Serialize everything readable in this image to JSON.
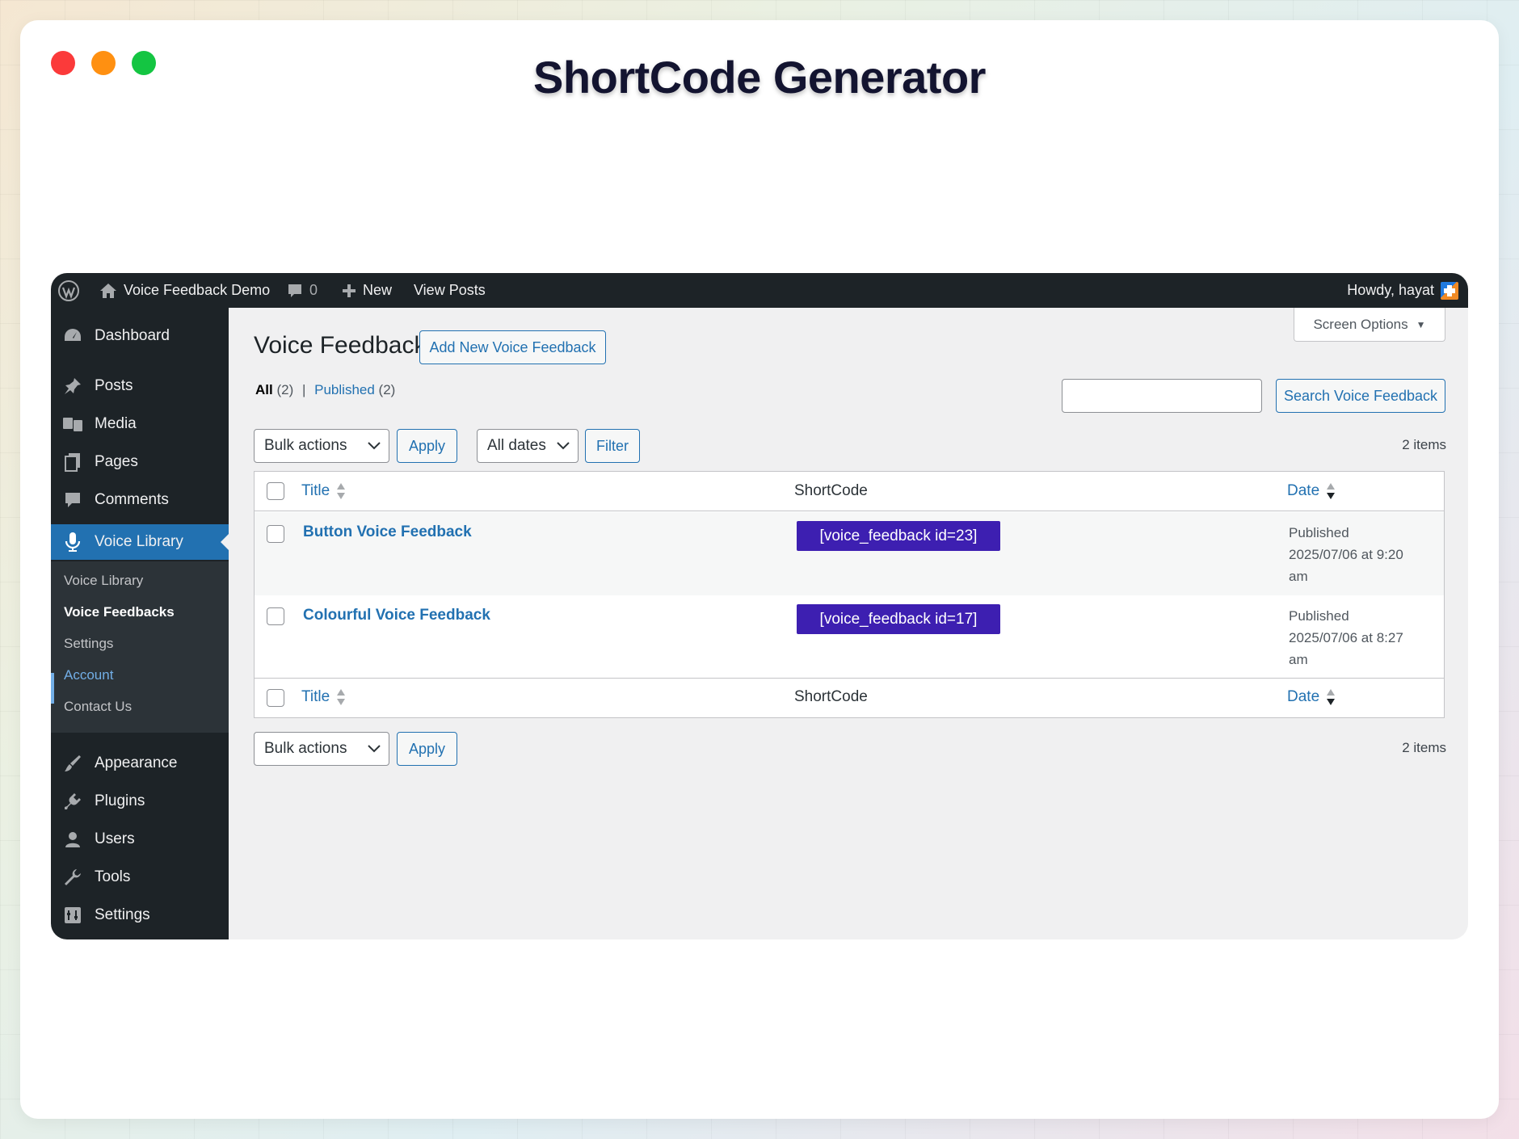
{
  "headline": "ShortCode Generator",
  "admin_bar": {
    "site_name": "Voice Feedback Demo",
    "comments_count": "0",
    "new_label": "New",
    "view_posts": "View Posts",
    "howdy": "Howdy, hayat"
  },
  "sidebar": {
    "items": [
      {
        "label": "Dashboard",
        "icon": "dashboard-icon"
      },
      {
        "label": "Posts",
        "icon": "pin-icon"
      },
      {
        "label": "Media",
        "icon": "media-icon"
      },
      {
        "label": "Pages",
        "icon": "pages-icon"
      },
      {
        "label": "Comments",
        "icon": "comment-icon"
      },
      {
        "label": "Voice Library",
        "icon": "microphone-icon"
      },
      {
        "label": "Appearance",
        "icon": "brush-icon"
      },
      {
        "label": "Plugins",
        "icon": "plugin-icon"
      },
      {
        "label": "Users",
        "icon": "user-icon"
      },
      {
        "label": "Tools",
        "icon": "wrench-icon"
      },
      {
        "label": "Settings",
        "icon": "settings-icon"
      }
    ],
    "submenu": [
      "Voice Library",
      "Voice Feedbacks",
      "Settings",
      "Account",
      "Contact Us"
    ]
  },
  "page": {
    "title": "Voice Feedbacks",
    "add_new": "Add New Voice Feedback",
    "screen_options": "Screen Options",
    "filter_all": "All",
    "filter_all_count": "(2)",
    "separator": "|",
    "filter_published": "Published",
    "filter_published_count": "(2)",
    "search_placeholder": "",
    "search_button": "Search Voice Feedback",
    "bulk_actions": "Bulk actions",
    "apply": "Apply",
    "all_dates": "All dates",
    "filter_button": "Filter",
    "items_count": "2 items"
  },
  "table": {
    "columns": {
      "title": "Title",
      "shortcode": "ShortCode",
      "date": "Date"
    },
    "rows": [
      {
        "title": "Button Voice Feedback",
        "shortcode": "[voice_feedback id=23]",
        "status": "Published",
        "date": "2025/07/06 at 9:20",
        "ampm": "am"
      },
      {
        "title": "Colourful Voice Feedback",
        "shortcode": "[voice_feedback id=17]",
        "status": "Published",
        "date": "2025/07/06 at 8:27",
        "ampm": "am"
      }
    ]
  },
  "colors": {
    "accent": "#2271b1",
    "sidebar": "#1d2327",
    "shortcode_bg": "#3d1fb1"
  }
}
